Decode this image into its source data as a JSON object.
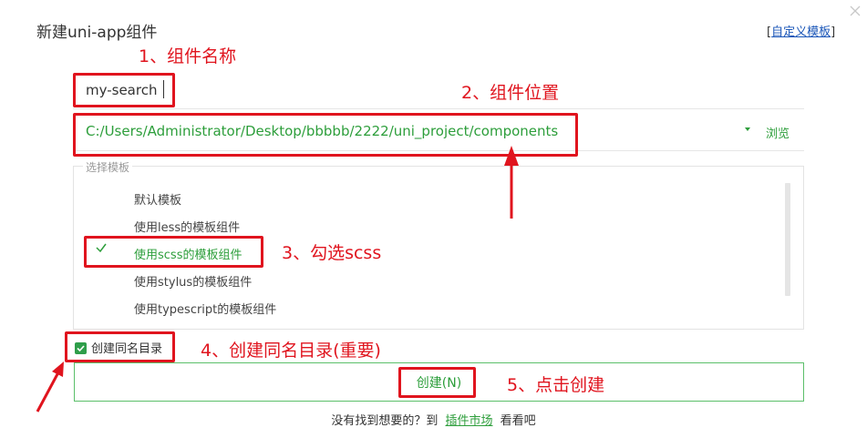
{
  "dialog": {
    "title": "新建uni-app组件",
    "custom_template_link": "自定义模板"
  },
  "name_field": {
    "value": "my-search"
  },
  "path_field": {
    "value": "C:/Users/Administrator/Desktop/bbbbb/2222/uni_project/components",
    "browse_label": "浏览"
  },
  "templates": {
    "legend": "选择模板",
    "items": [
      {
        "label": "默认模板"
      },
      {
        "label": "使用less的模板组件"
      },
      {
        "label": "使用scss的模板组件"
      },
      {
        "label": "使用stylus的模板组件"
      },
      {
        "label": "使用typescript的模板组件"
      }
    ],
    "selected_index": 2
  },
  "same_dir": {
    "label": "创建同名目录",
    "checked": true
  },
  "create_button": {
    "label": "创建(N)"
  },
  "footer": {
    "prefix": "没有找到想要的？到",
    "market_link": "插件市场",
    "suffix": "看看吧"
  },
  "annotations": {
    "step1": "1、组件名称",
    "step2": "2、组件位置",
    "step3": "3、勾选scss",
    "step4": "4、创建同名目录(重要)",
    "step5": "5、点击创建"
  },
  "colors": {
    "accent_green": "#2d9e3b",
    "annotation_red": "#e0141e",
    "link_blue": "#1a56b8"
  }
}
